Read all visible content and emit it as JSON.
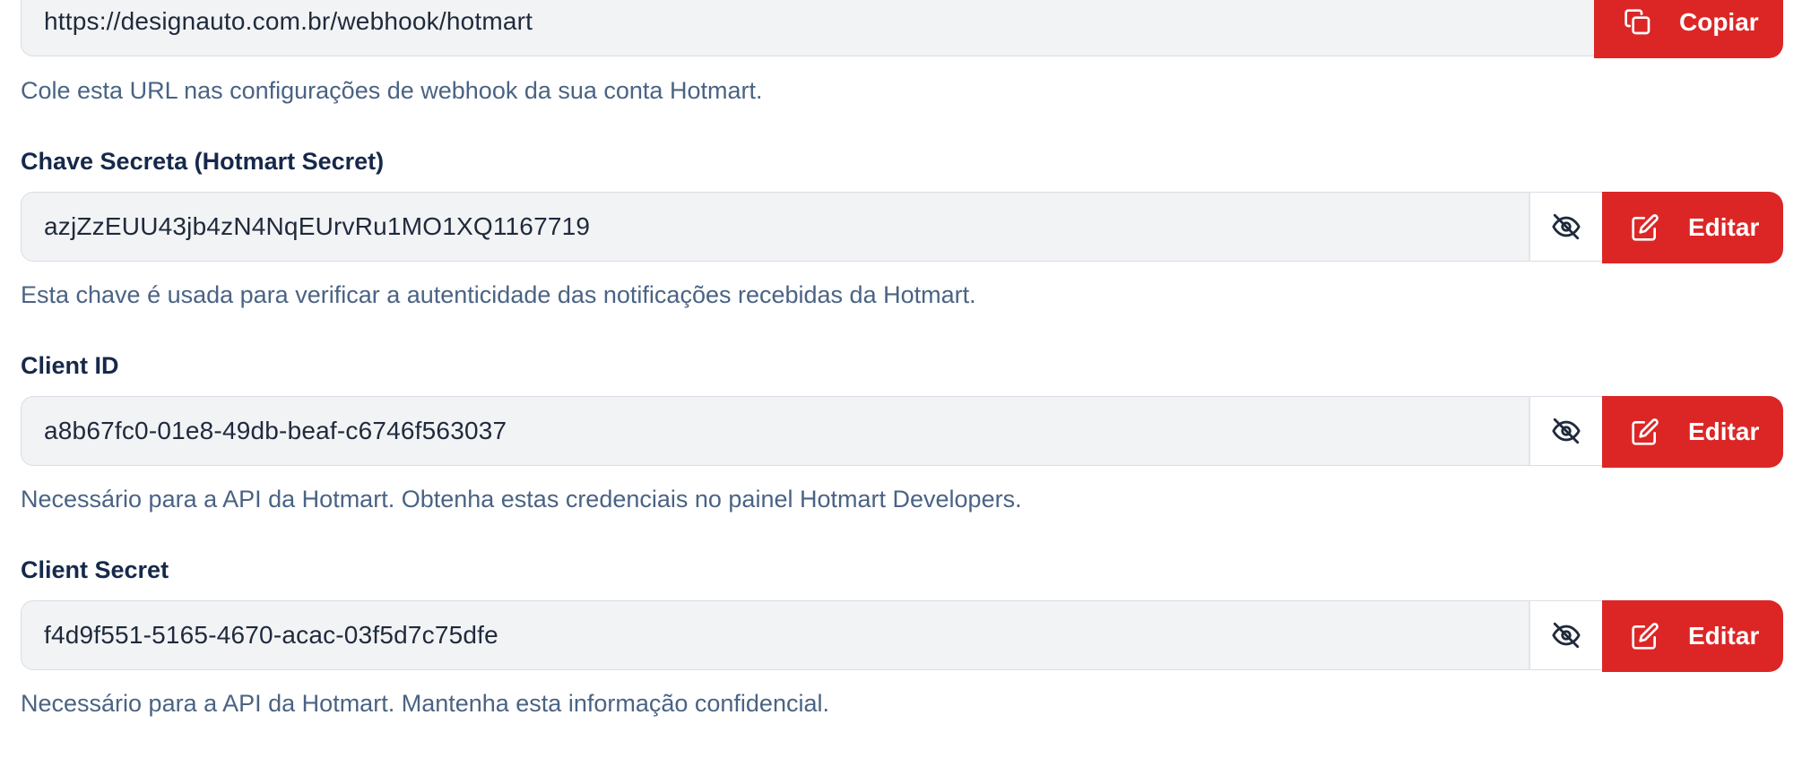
{
  "webhook": {
    "url": "https://designauto.com.br/webhook/hotmart",
    "copy_label": "Copiar",
    "help": "Cole esta URL nas configurações de webhook da sua conta Hotmart."
  },
  "secret": {
    "label": "Chave Secreta (Hotmart Secret)",
    "value": "azjZzEUU43jb4zN4NqEUrvRu1MO1XQ1167719",
    "edit_label": "Editar",
    "help": "Esta chave é usada para verificar a autenticidade das notificações recebidas da Hotmart."
  },
  "client_id": {
    "label": "Client ID",
    "value": "a8b67fc0-01e8-49db-beaf-c6746f563037",
    "edit_label": "Editar",
    "help": "Necessário para a API da Hotmart. Obtenha estas credenciais no painel Hotmart Developers."
  },
  "client_secret": {
    "label": "Client Secret",
    "value": "f4d9f551-5165-4670-acac-03f5d7c75dfe",
    "edit_label": "Editar",
    "help": "Necessário para a API da Hotmart. Mantenha esta informação confidencial."
  },
  "icons": {
    "copy": "copy-icon",
    "visibility": "eye-off-icon",
    "edit": "edit-icon"
  },
  "colors": {
    "accent": "#dc2626",
    "label": "#16294a",
    "help": "#4a6384",
    "input_bg": "#f2f3f5"
  }
}
